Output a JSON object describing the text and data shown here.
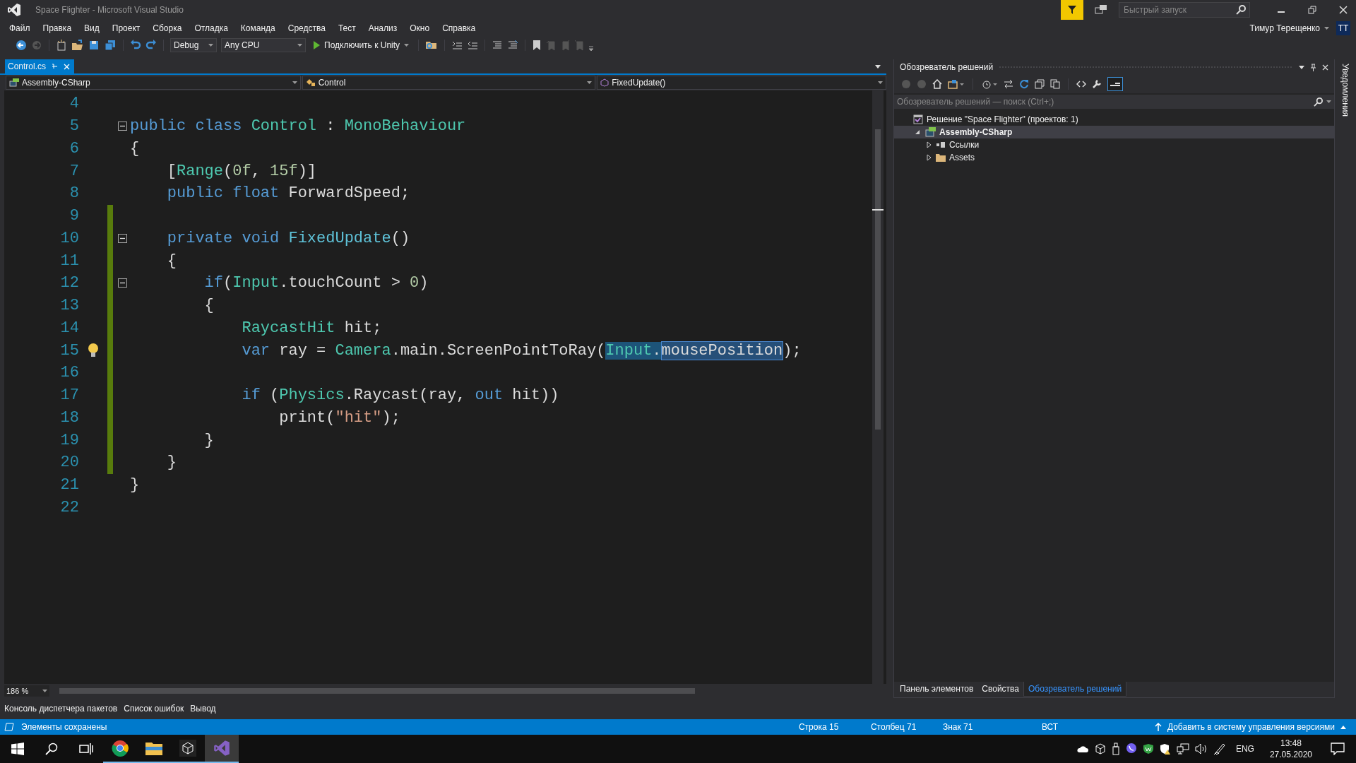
{
  "window": {
    "title": "Space Flighter - Microsoft Visual Studio",
    "quick_launch": {
      "placeholder": "Быстрый запуск"
    },
    "user": {
      "name": "Тимур Терещенко",
      "initials": "TT"
    }
  },
  "menu": [
    "Файл",
    "Правка",
    "Вид",
    "Проект",
    "Сборка",
    "Отладка",
    "Команда",
    "Средства",
    "Тест",
    "Анализ",
    "Окно",
    "Справка"
  ],
  "toolbar": {
    "configuration": "Debug",
    "platform": "Any CPU",
    "start": "Подключить к Unity"
  },
  "document_tabs": [
    {
      "label": "Control.cs",
      "selected": true
    }
  ],
  "navigation": {
    "project": "Assembly-CSharp",
    "type": "Control",
    "member": "FixedUpdate()"
  },
  "editor": {
    "zoom": "186 %",
    "lines": [
      {
        "number": "4",
        "changed": false
      },
      {
        "number": "5",
        "changed": false,
        "folded": false,
        "code": [
          {
            "text": "public",
            "kind": "keyword"
          },
          {
            "text": " class",
            "kind": "keyword"
          },
          {
            "text": " Control",
            "kind": "type"
          },
          {
            "text": " : ",
            "kind": "plain"
          },
          {
            "text": "MonoBehaviour",
            "kind": "type"
          }
        ]
      },
      {
        "number": "6",
        "changed": false,
        "code": [
          {
            "text": "{",
            "kind": "plain"
          }
        ]
      },
      {
        "number": "7",
        "changed": false,
        "code": [
          {
            "text": "    [",
            "kind": "plain"
          },
          {
            "text": "Range",
            "kind": "type"
          },
          {
            "text": "(",
            "kind": "plain"
          },
          {
            "text": "0f",
            "kind": "number"
          },
          {
            "text": ", ",
            "kind": "plain"
          },
          {
            "text": "15f",
            "kind": "number"
          },
          {
            "text": ")]",
            "kind": "plain"
          }
        ]
      },
      {
        "number": "8",
        "changed": false,
        "code": [
          {
            "text": "    public",
            "kind": "keyword"
          },
          {
            "text": " float",
            "kind": "keyword"
          },
          {
            "text": " ForwardSpeed;",
            "kind": "plain"
          }
        ]
      },
      {
        "number": "9",
        "changed": true
      },
      {
        "number": "10",
        "changed": true,
        "folded": false,
        "code": [
          {
            "text": "    private",
            "kind": "keyword"
          },
          {
            "text": " void",
            "kind": "keyword"
          },
          {
            "text": " FixedUpdate",
            "kind": "method"
          },
          {
            "text": "()",
            "kind": "plain"
          }
        ]
      },
      {
        "number": "11",
        "changed": true,
        "code": [
          {
            "text": "    {",
            "kind": "plain"
          }
        ]
      },
      {
        "number": "12",
        "changed": true,
        "folded": false,
        "code": [
          {
            "text": "        if",
            "kind": "keyword"
          },
          {
            "text": "(",
            "kind": "plain"
          },
          {
            "text": "Input",
            "kind": "type"
          },
          {
            "text": ".touchCount > ",
            "kind": "plain"
          },
          {
            "text": "0",
            "kind": "number"
          },
          {
            "text": ")",
            "kind": "plain"
          }
        ]
      },
      {
        "number": "13",
        "changed": true,
        "code": [
          {
            "text": "        {",
            "kind": "plain"
          }
        ]
      },
      {
        "number": "14",
        "changed": true,
        "code": [
          {
            "text": "            RaycastHit",
            "kind": "type"
          },
          {
            "text": " hit;",
            "kind": "plain"
          }
        ]
      },
      {
        "number": "15",
        "changed": true,
        "lightbulb": true,
        "code": [
          {
            "text": "            var",
            "kind": "keyword"
          },
          {
            "text": " ray = ",
            "kind": "plain"
          },
          {
            "text": "Camera",
            "kind": "type"
          },
          {
            "text": ".main.ScreenPointToRay(",
            "kind": "plain"
          },
          {
            "text": "Input",
            "kind": "type",
            "reference": true
          },
          {
            "text": ".",
            "kind": "plain",
            "reference": true
          },
          {
            "text": "mousePosition",
            "kind": "plain",
            "selected": true
          },
          {
            "text": ");",
            "kind": "plain"
          }
        ]
      },
      {
        "number": "16",
        "changed": true
      },
      {
        "number": "17",
        "changed": true,
        "code": [
          {
            "text": "            if",
            "kind": "keyword"
          },
          {
            "text": " (",
            "kind": "plain"
          },
          {
            "text": "Physics",
            "kind": "type"
          },
          {
            "text": ".Raycast(ray, ",
            "kind": "plain"
          },
          {
            "text": "out",
            "kind": "keyword"
          },
          {
            "text": " hit))",
            "kind": "plain"
          }
        ]
      },
      {
        "number": "18",
        "changed": true,
        "code": [
          {
            "text": "                print(",
            "kind": "plain"
          },
          {
            "text": "\"hit\"",
            "kind": "string"
          },
          {
            "text": ");",
            "kind": "plain"
          }
        ]
      },
      {
        "number": "19",
        "changed": true,
        "code": [
          {
            "text": "        }",
            "kind": "plain"
          }
        ]
      },
      {
        "number": "20",
        "changed": true,
        "code": [
          {
            "text": "    }",
            "kind": "plain"
          }
        ]
      },
      {
        "number": "21",
        "changed": false,
        "code": [
          {
            "text": "}",
            "kind": "plain"
          }
        ]
      },
      {
        "number": "22",
        "changed": false
      }
    ]
  },
  "bottom_tabs": [
    "Консоль диспетчера пакетов",
    "Список ошибок",
    "Вывод"
  ],
  "solution_explorer": {
    "title": "Обозреватель решений",
    "search": {
      "placeholder": "Обозреватель решений — поиск (Ctrl+;)"
    },
    "tree": [
      {
        "label": "Решение \"Space Flighter\"  (проектов: 1)",
        "kind": "solution",
        "selected": false,
        "children": [
          {
            "label": "Assembly-CSharp",
            "kind": "project",
            "expanded": true,
            "selected": true,
            "children": [
              {
                "label": "Ссылки",
                "kind": "references",
                "expanded": false,
                "selected": false
              },
              {
                "label": "Assets",
                "kind": "folder",
                "expanded": false,
                "selected": false
              }
            ]
          }
        ]
      }
    ],
    "tabs": [
      {
        "label": "Панель элементов",
        "selected": false
      },
      {
        "label": "Свойства",
        "selected": false
      },
      {
        "label": "Обозреватель решений",
        "selected": true
      }
    ]
  },
  "side_strip": "Уведомления",
  "status_bar": {
    "message": "Элементы сохранены",
    "line": "Строка 15",
    "column": "Столбец 71",
    "char": "Знак 71",
    "mode": "ВСТ",
    "source_control": "Добавить в систему управления версиями"
  },
  "taskbar": {
    "apps": [
      {
        "kind": "browser",
        "running": true,
        "selected": false
      },
      {
        "kind": "folder",
        "running": true,
        "selected": false
      },
      {
        "kind": "unity",
        "running": true,
        "selected": false
      },
      {
        "kind": "studio",
        "running": true,
        "selected": true
      }
    ],
    "language": "ENG",
    "time": "13:48",
    "date": "27.05.2020"
  }
}
